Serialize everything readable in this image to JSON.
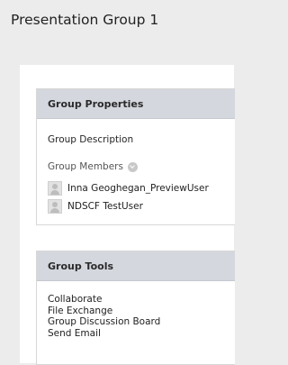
{
  "page": {
    "title": "Presentation Group 1"
  },
  "group_properties": {
    "header": "Group Properties",
    "description_label": "Group Description",
    "members_label": "Group Members",
    "members": [
      {
        "name": "Inna Geoghegan_PreviewUser"
      },
      {
        "name": "NDSCF TestUser"
      }
    ]
  },
  "group_tools": {
    "header": "Group Tools",
    "links": [
      {
        "label": "Collaborate"
      },
      {
        "label": "File Exchange"
      },
      {
        "label": "Group Discussion Board"
      },
      {
        "label": "Send Email"
      }
    ]
  },
  "colors": {
    "page_bg": "#ececec",
    "panel_header_bg": "#d4d7de"
  }
}
